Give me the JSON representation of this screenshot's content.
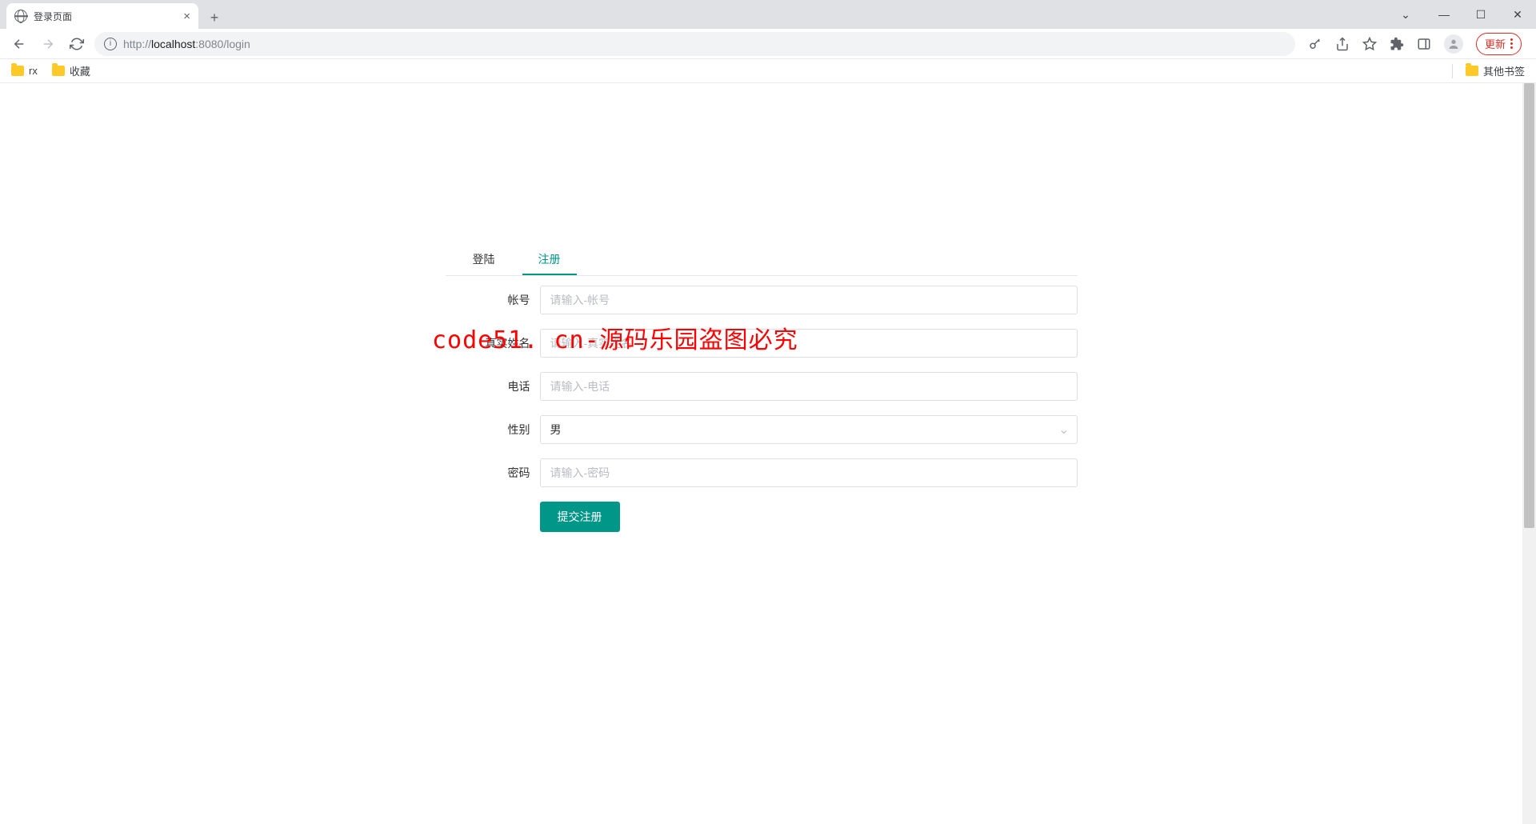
{
  "browser": {
    "tab_title": "登录页面",
    "url_protocol": "http://",
    "url_host": "localhost",
    "url_port_path": ":8080/login",
    "update_label": "更新",
    "bookmarks": [
      {
        "label": "rx"
      },
      {
        "label": "收藏"
      }
    ],
    "other_bookmarks": "其他书签"
  },
  "tabs": {
    "login": "登陆",
    "register": "注册"
  },
  "form": {
    "account": {
      "label": "帐号",
      "placeholder": "请输入-帐号"
    },
    "realname": {
      "label": "真实姓名",
      "placeholder": "请输入-真实姓名"
    },
    "phone": {
      "label": "电话",
      "placeholder": "请输入-电话"
    },
    "gender": {
      "label": "性别",
      "value": "男"
    },
    "password": {
      "label": "密码",
      "placeholder": "请输入-密码"
    },
    "submit": "提交注册"
  },
  "watermark": "code51. cn-源码乐园盗图必究"
}
